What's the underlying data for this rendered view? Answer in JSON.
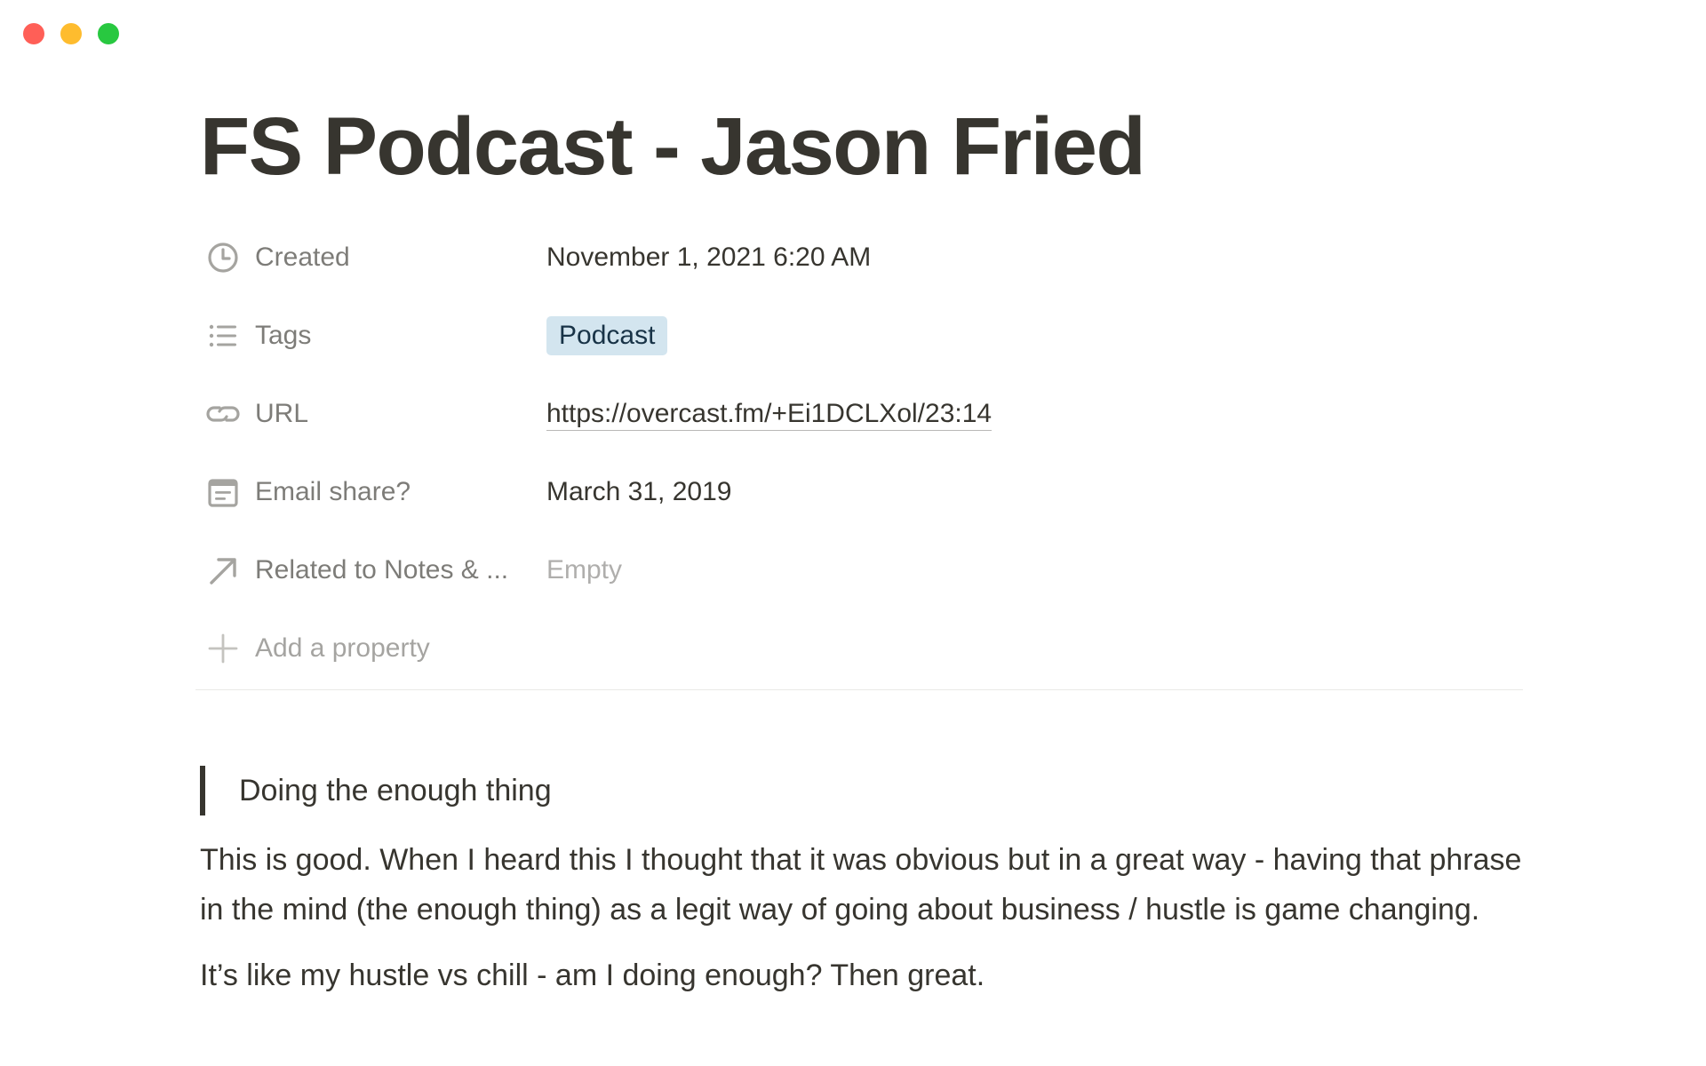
{
  "window": {
    "traffic_lights": [
      {
        "name": "close",
        "color": "#ff5f57"
      },
      {
        "name": "minimize",
        "color": "#febc2e"
      },
      {
        "name": "zoom",
        "color": "#28c840"
      }
    ]
  },
  "page": {
    "title": "FS Podcast - Jason Fried"
  },
  "properties": {
    "created": {
      "icon": "clock-icon",
      "label": "Created",
      "value": "November 1, 2021 6:20 AM"
    },
    "tags": {
      "icon": "list-icon",
      "label": "Tags",
      "value": "Podcast",
      "tag_color": "#d3e5ef"
    },
    "url": {
      "icon": "link-icon",
      "label": "URL",
      "value": "https://overcast.fm/+Ei1DCLXol/23:14"
    },
    "email_share": {
      "icon": "calendar-icon",
      "label": "Email share?",
      "value": "March 31, 2019"
    },
    "related": {
      "icon": "arrow-up-right-icon",
      "label": "Related to Notes & ...",
      "value": "Empty"
    },
    "add_property": {
      "icon": "plus-icon",
      "label": "Add a property"
    }
  },
  "content": {
    "quote": "Doing the enough thing",
    "paragraphs": [
      "This is good. When I heard this I thought that it was obvious but in a great way - having that phrase in the mind (the enough thing) as a legit way of going about business / hustle is game changing.",
      "It’s like my hustle vs chill - am I doing enough? Then great."
    ]
  }
}
